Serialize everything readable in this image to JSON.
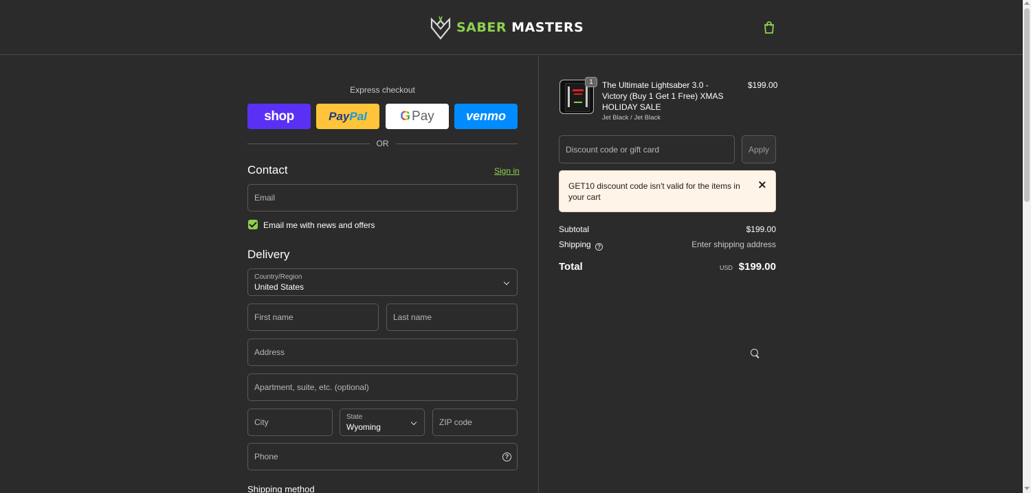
{
  "header": {
    "brand_part1": "SABER",
    "brand_part2": "MASTERS",
    "cart_icon": "shopping-bag-icon"
  },
  "express": {
    "title": "Express checkout",
    "shop_label": "shop",
    "paypal_label_1": "Pay",
    "paypal_label_2": "Pal",
    "gpay_label_g": "G",
    "gpay_label_pay": "Pay",
    "venmo_label": "venmo",
    "or": "OR"
  },
  "contact": {
    "title": "Contact",
    "signin": "Sign in",
    "email_placeholder": "Email",
    "newsletter_label": "Email me with news and offers",
    "newsletter_checked": true
  },
  "delivery": {
    "title": "Delivery",
    "country_label": "Country/Region",
    "country_value": "United States",
    "first_name_placeholder": "First name",
    "last_name_placeholder": "Last name",
    "address_placeholder": "Address",
    "apartment_placeholder": "Apartment, suite, etc. (optional)",
    "city_placeholder": "City",
    "state_label": "State",
    "state_value": "Wyoming",
    "zip_placeholder": "ZIP code",
    "phone_placeholder": "Phone",
    "shipping_method_title": "Shipping method"
  },
  "order": {
    "quantity": "1",
    "product_name": "The Ultimate Lightsaber 3.0 - Victory (Buy 1 Get 1 Free) XMAS HOLIDAY SALE",
    "variant": "Jet Black / Jet Black",
    "price": "$199.00",
    "discount_placeholder": "Discount code or gift card",
    "apply_label": "Apply",
    "alert_text": "GET10 discount code isn't valid for the items in your cart",
    "subtotal_label": "Subtotal",
    "subtotal_value": "$199.00",
    "shipping_label": "Shipping",
    "shipping_value": "Enter shipping address",
    "total_label": "Total",
    "currency": "USD",
    "total_value": "$199.00"
  },
  "colors": {
    "background": "#2b2b2b",
    "accent_green": "#8fd14f",
    "shop_purple": "#5a31f4",
    "paypal_yellow": "#ffc439",
    "venmo_blue": "#008cff",
    "alert_bg": "#fff4e8"
  }
}
